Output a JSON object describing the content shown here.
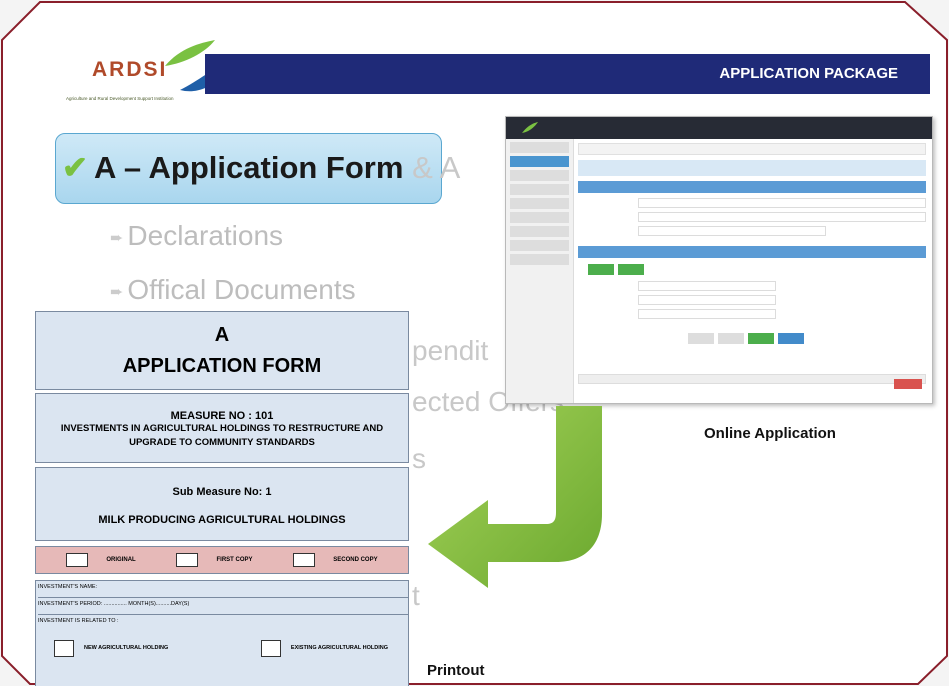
{
  "header": {
    "logo_text": "ARDSI",
    "logo_subtitle": "Agriculture and Rural Development Support Institution",
    "title": "APPLICATION PACKAGE"
  },
  "bullets": {
    "main": "A – Application Form",
    "main_rest": "& A",
    "items": [
      "Declarations",
      "Offical Documents"
    ],
    "ghost": [
      "pendit",
      "ected Offers",
      "s",
      "t"
    ]
  },
  "online": {
    "caption": "Online Application"
  },
  "printout": {
    "caption": "Printout",
    "letter": "A",
    "title": "APPLICATION FORM",
    "measure_no": "MEASURE NO : 101",
    "measure_desc_1": "INVESTMENTS IN AGRICULTURAL HOLDINGS TO RESTRUCTURE AND",
    "measure_desc_2": "UPGRADE  TO COMMUNITY STANDARDS",
    "sub_measure": "Sub Measure No: 1",
    "sub_measure_desc": "MILK PRODUCING AGRICULTURAL HOLDINGS",
    "copies": [
      "ORIGINAL",
      "FIRST COPY",
      "SECOND COPY"
    ],
    "fields": [
      "INVESTMENT'S NAME:",
      "INVESTMENT'S PERIOD: ............... MONTH(S)..........DAY(S)",
      "INVESTMENT IS RELATED TO :"
    ],
    "holdings": [
      "NEW AGRICULTURAL HOLDING",
      "EXISTING AGRICULTURAL HOLDING"
    ]
  },
  "colors": {
    "header_bar": "#1f2a78",
    "frame": "#8a1f2b",
    "arrow": "#8cc540",
    "form_bg": "#dbe5f1",
    "copies_bg": "#e6b9b8"
  }
}
